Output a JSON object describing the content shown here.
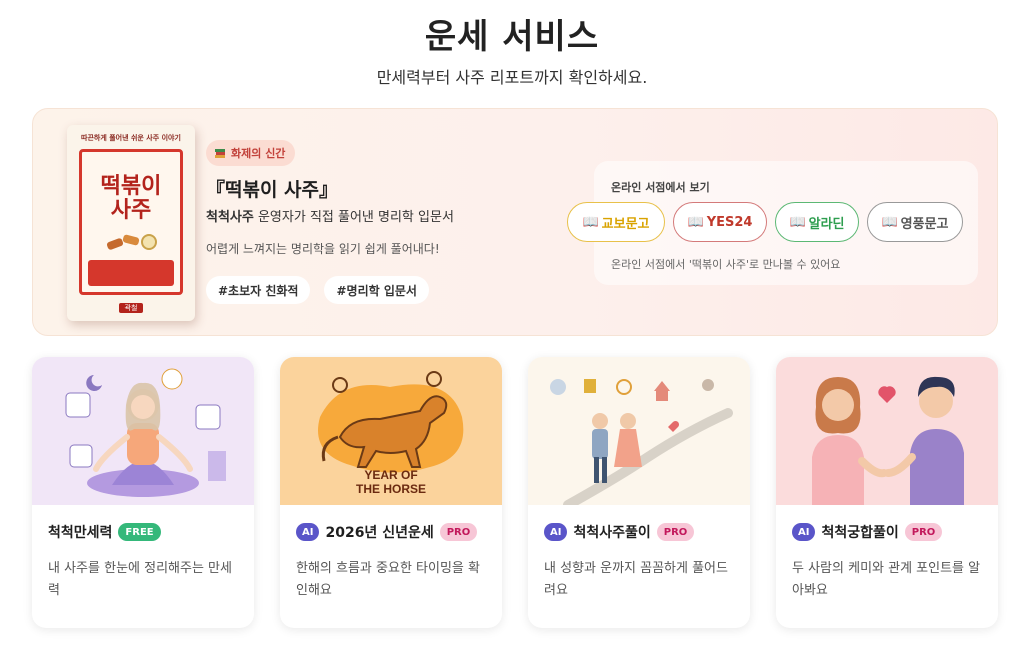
{
  "header": {
    "title": "운세 서비스",
    "subtitle": "만세력부터 사주 리포트까지 확인하세요."
  },
  "banner": {
    "badge": "화제의 신간",
    "book_title": "『떡볶이 사주』",
    "desc_strong": "척척사주",
    "desc_rest": " 운영자가 직접 풀어낸 명리학 입문서",
    "sub": "어렵게 느껴지는 명리학을 읽기 쉽게 풀어내다!",
    "tags": [
      "#초보자 친화적",
      "#명리학 입문서"
    ],
    "cover": {
      "top_text": "따끈하게 풀어낸 쉬운 사주 이야기",
      "title_line1": "떡볶이",
      "title_line2": "사주",
      "foot": "곽철"
    },
    "store_label": "온라인 서점에서 보기",
    "stores": [
      {
        "label": "교보문고",
        "color": "#d9a300"
      },
      {
        "label": "YES24",
        "color": "#c0392b"
      },
      {
        "label": "알라딘",
        "color": "#2e9e4f"
      },
      {
        "label": "영풍문고",
        "color": "#555555"
      }
    ],
    "store_note": "온라인 서점에서 '떡볶이 사주'로 만나볼 수 있어요"
  },
  "cards": [
    {
      "title": "척척만세력",
      "badge": "FREE",
      "desc": "내 사주를 한눈에 정리해주는 만세력",
      "ai": false
    },
    {
      "title": "2026년 신년운세",
      "badge": "PRO",
      "desc": "한해의 흐름과 중요한 타이밍을 확인해요",
      "ai": true,
      "illustration_text": "YEAR OF THE HORSE"
    },
    {
      "title": "척척사주풀이",
      "badge": "PRO",
      "desc": "내 성향과 운까지 꼼꼼하게 풀어드려요",
      "ai": true
    },
    {
      "title": "척척궁합풀이",
      "badge": "PRO",
      "desc": "두 사람의 케미와 관계 포인트를 알아봐요",
      "ai": true
    }
  ],
  "ai_label": "AI"
}
